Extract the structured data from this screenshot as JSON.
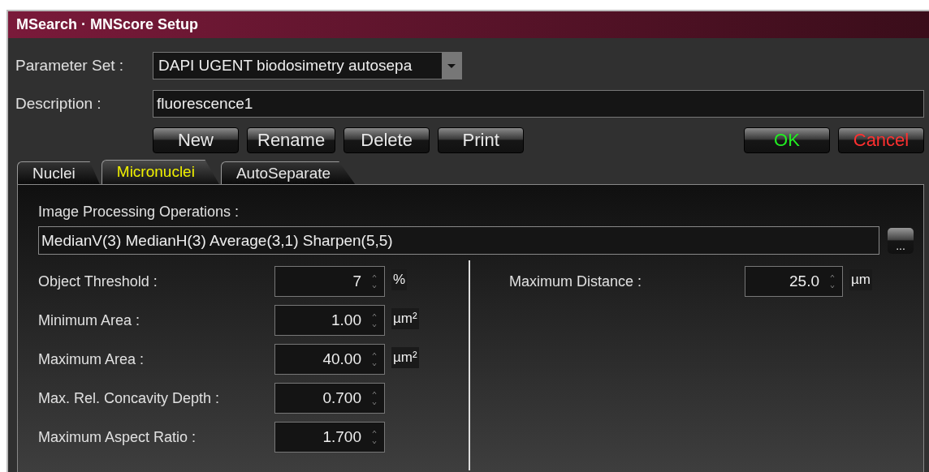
{
  "window": {
    "title": "MSearch · MNScore Setup"
  },
  "parameter_set": {
    "label": "Parameter Set :",
    "value": "DAPI UGENT biodosimetry autosepa"
  },
  "description": {
    "label": "Description :",
    "value": "fluorescence1"
  },
  "buttons": [
    {
      "label": "New",
      "kind": "normal"
    },
    {
      "label": "Rename",
      "kind": "normal"
    },
    {
      "label": "Delete",
      "kind": "normal"
    },
    {
      "label": "Print",
      "kind": "normal"
    },
    {
      "label": "OK",
      "kind": "ok"
    },
    {
      "label": "Cancel",
      "kind": "cancel"
    }
  ],
  "tabs": [
    {
      "label": "Nuclei",
      "selected": false
    },
    {
      "label": "Micronuclei",
      "selected": true
    },
    {
      "label": "AutoSeparate",
      "selected": false
    }
  ],
  "image_processing": {
    "label": "Image Processing Operations :",
    "value": "MedianV(3) MedianH(3) Average(3,1) Sharpen(5,5)",
    "button": "..."
  },
  "left_fields": [
    {
      "label": "Object Threshold :",
      "value": "7",
      "unit": "%"
    },
    {
      "label": "Minimum Area :",
      "value": "1.00",
      "unit": "µm²"
    },
    {
      "label": "Maximum Area :",
      "value": "40.00",
      "unit": "µm²"
    },
    {
      "label": "Max. Rel. Concavity Depth :",
      "value": "0.700"
    },
    {
      "label": "Maximum Aspect Ratio :",
      "value": "1.700"
    }
  ],
  "right_fields": [
    {
      "label": "Maximum Distance :",
      "value": "25.0",
      "unit": "µm"
    }
  ]
}
